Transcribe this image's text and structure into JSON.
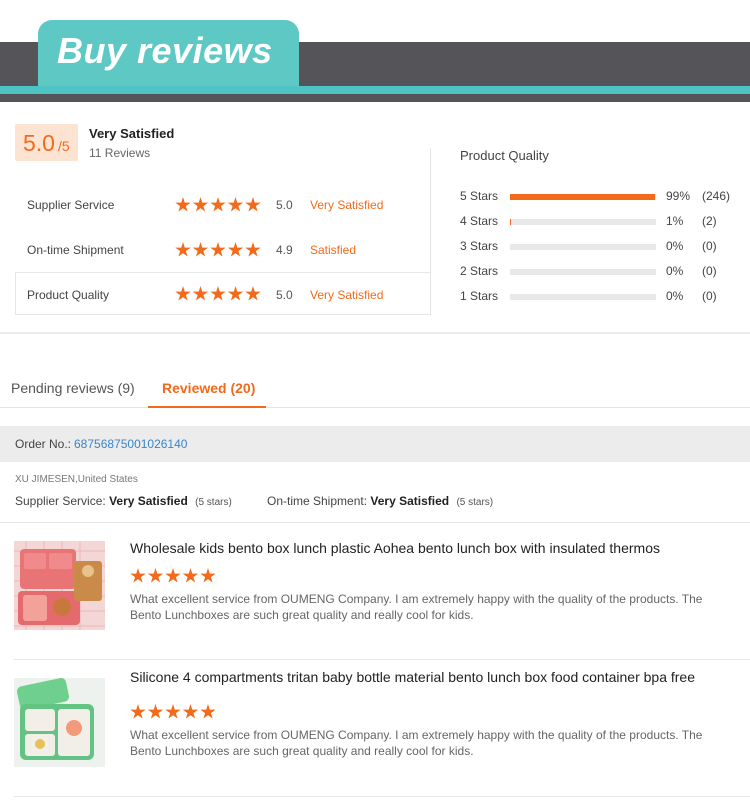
{
  "banner": {
    "title": "Buy reviews"
  },
  "summary": {
    "score": "5.0",
    "score_denominator": "/5",
    "rating_text": "Very Satisfied",
    "review_count": "11 Reviews",
    "metrics": [
      {
        "label": "Supplier Service",
        "stars": 5,
        "value": "5.0",
        "text": "Very Satisfied"
      },
      {
        "label": "On-time Shipment",
        "stars": 5,
        "value": "4.9",
        "text": "Satisfied"
      },
      {
        "label": "Product Quality",
        "stars": 5,
        "value": "5.0",
        "text": "Very Satisfied"
      }
    ]
  },
  "product_quality": {
    "title": "Product Quality",
    "distribution": [
      {
        "label": "5 Stars",
        "percent_text": "99%",
        "percent": 99,
        "count": "(246)"
      },
      {
        "label": "4 Stars",
        "percent_text": "1%",
        "percent": 1,
        "count": "(2)"
      },
      {
        "label": "3 Stars",
        "percent_text": "0%",
        "percent": 0,
        "count": "(0)"
      },
      {
        "label": "2 Stars",
        "percent_text": "0%",
        "percent": 0,
        "count": "(0)"
      },
      {
        "label": "1 Stars",
        "percent_text": "0%",
        "percent": 0,
        "count": "(0)"
      }
    ]
  },
  "tabs": [
    {
      "label": "Pending reviews (9)",
      "active": false
    },
    {
      "label": "Reviewed (20)",
      "active": true
    }
  ],
  "order": {
    "label": "Order No.:",
    "number": "68756875001026140",
    "buyer": "XU JIMESEN,United States",
    "supplier_service_label": "Supplier Service:",
    "supplier_service_value": "Very Satisfied",
    "supplier_service_stars": "(5 stars)",
    "shipment_label": "On-time Shipment:",
    "shipment_value": "Very Satisfied",
    "shipment_stars": "(5 stars)"
  },
  "reviews": [
    {
      "title": "Wholesale kids bento box lunch plastic Aohea bento lunch box with insulated thermos",
      "stars": 5,
      "text": "What excellent service from OUMENG Company. I am extremely happy with the quality of the products. The Bento Lunchboxes are such great quality and really cool for kids.",
      "thumb_color": "#e97a7c"
    },
    {
      "title": "Silicone 4 compartments tritan baby bottle material bento lunch box food container bpa free",
      "stars": 5,
      "text": "What excellent service from OUMENG Company. I am extremely happy with the quality of the products. The Bento Lunchboxes are such great quality and really cool for kids.",
      "thumb_color": "#6fcf8f"
    }
  ],
  "colors": {
    "accent": "#f26a1b",
    "teal": "#5ec8c4",
    "link": "#3a86c8"
  }
}
